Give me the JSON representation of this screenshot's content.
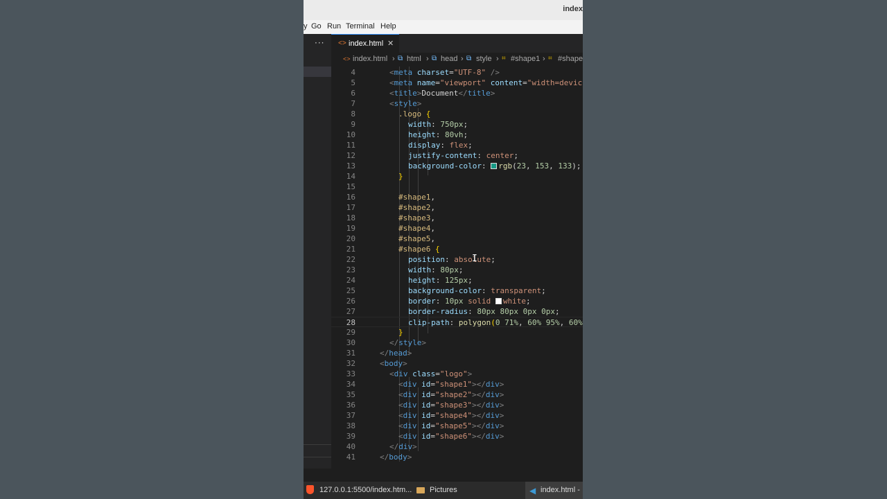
{
  "window": {
    "title": "index"
  },
  "menu": {
    "items": [
      "Go",
      "Run",
      "Terminal",
      "Help"
    ]
  },
  "sidebar": {
    "more_label": "···"
  },
  "tab": {
    "label": "index.html",
    "close": "✕"
  },
  "breadcrumb": [
    "index.html",
    "html",
    "head",
    "style",
    "#shape1",
    "#shape"
  ],
  "editor": {
    "active_line": 28,
    "line_numbers": [
      "4",
      "5",
      "6",
      "7",
      "8",
      "9",
      "10",
      "11",
      "12",
      "13",
      "14",
      "15",
      "16",
      "17",
      "18",
      "19",
      "20",
      "21",
      "22",
      "23",
      "24",
      "25",
      "26",
      "27",
      "28",
      "29",
      "30",
      "31",
      "32",
      "33",
      "34",
      "35",
      "36",
      "37",
      "38",
      "39",
      "40",
      "41"
    ],
    "swatch_colors": {
      "teal": "#179985",
      "white": "#ffffff"
    }
  },
  "taskbar": {
    "browser": "127.0.0.1:5500/index.htm...",
    "folder": "Pictures",
    "editor": "index.html - "
  },
  "colors": {
    "accent": "#3794ff",
    "editor_bg": "#1e1e1e"
  }
}
